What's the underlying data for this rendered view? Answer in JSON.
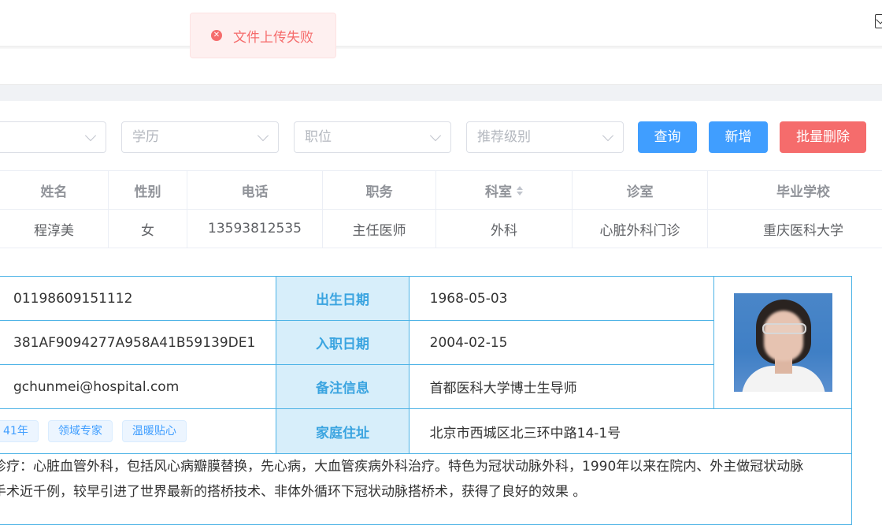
{
  "toast": {
    "message": "文件上传失败",
    "icon": "error-circle-icon",
    "color": "#f56c6c"
  },
  "filters": [
    {
      "placeholder": ""
    },
    {
      "placeholder": "学历"
    },
    {
      "placeholder": "职位"
    },
    {
      "placeholder": "推荐级别"
    }
  ],
  "buttons": {
    "query": "查询",
    "add": "新增",
    "batch_delete": "批量删除"
  },
  "colors": {
    "primary": "#409eff",
    "danger": "#f56c6c",
    "detail_border": "#4db3e6",
    "detail_label_bg": "#d7eefa"
  },
  "table": {
    "headers": [
      "姓名",
      "性别",
      "电话",
      "职务",
      "科室",
      "诊室",
      "毕业学校"
    ],
    "sortable_header": "科室",
    "row": [
      "程淳美",
      "女",
      "13593812535",
      "主任医师",
      "外科",
      "心脏外科门诊",
      "重庆医科大学"
    ]
  },
  "detail": {
    "id_number": "01198609151112",
    "hash": "381AF9094277A958A41B59139DE1",
    "email": "gchunmei@hospital.com",
    "tags": [
      "41年",
      "领域专家",
      "温暖贴心"
    ],
    "labels": {
      "birth": "出生日期",
      "hire": "入职日期",
      "note": "备注信息",
      "address": "家庭住址"
    },
    "birth": "1968-05-03",
    "hire": "2004-02-15",
    "note": "首都医科大学博士生导师",
    "address": "北京市西城区北三环中路14-1号",
    "bio_line1": "诊疗：心脏血管外科，包括风心病瓣膜替换，先心病，大血管疾病外科治疗。特色为冠状动脉外科，1990年以来在院内、外主做冠状动脉",
    "bio_line2": "手术近千例，较早引进了世界最新的搭桥技术、非体外循环下冠状动脉搭桥术，获得了良好的效果 。"
  }
}
